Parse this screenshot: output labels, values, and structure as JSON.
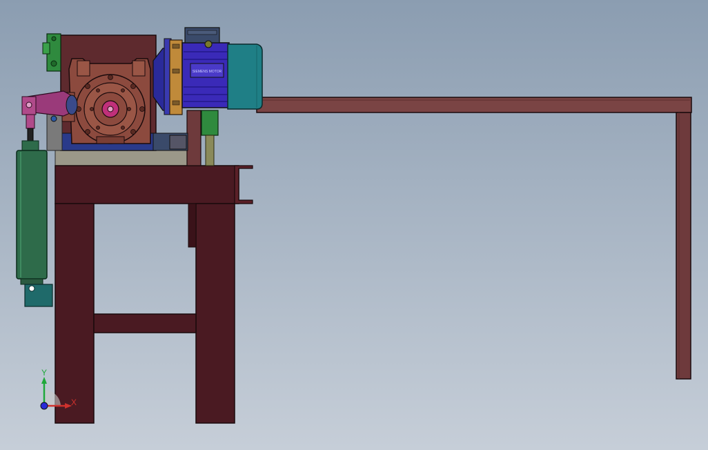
{
  "viewport": {
    "background_top": "#8b9db1",
    "background_bottom": "#c6ced8"
  },
  "colors": {
    "frame": "#4a1a22",
    "frame_dark": "#3a1219",
    "rail": "#7a4444",
    "gearbox": "#8c4a3e",
    "motor_blue": "#3a2ab8",
    "motor_teal": "#1f7f86",
    "cylinder_green": "#2e6b4a",
    "bracket_green": "#2f8a3e",
    "crank_magenta": "#9a3a7a"
  },
  "motor": {
    "nameplate_text": "SIEMENS MOTOR"
  },
  "triad": {
    "y_label": "Y",
    "x_label": "X",
    "y_color": "#1fa83a",
    "x_color": "#d0312d",
    "z_color": "#2a2ad8"
  }
}
